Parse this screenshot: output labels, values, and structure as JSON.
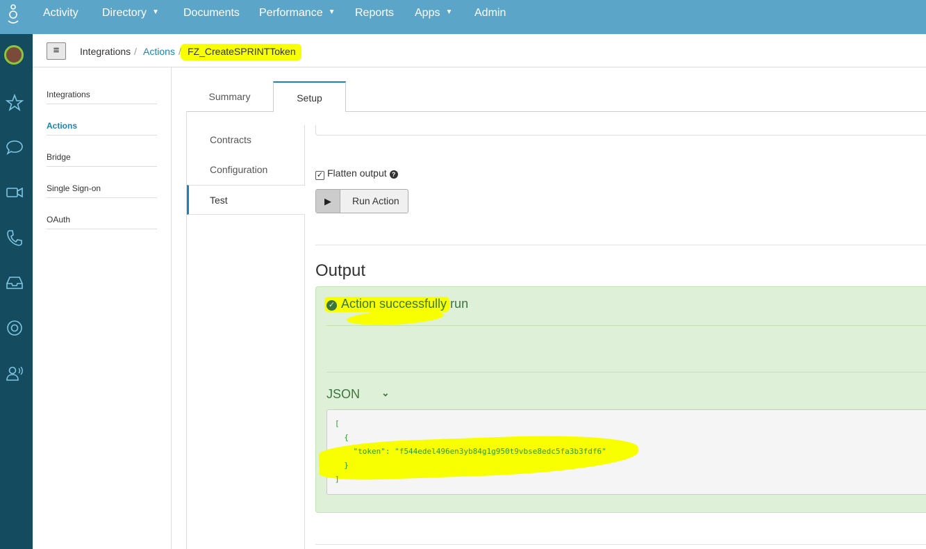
{
  "topnav": {
    "items": [
      {
        "label": "Activity",
        "has_caret": false
      },
      {
        "label": "Directory",
        "has_caret": true
      },
      {
        "label": "Documents",
        "has_caret": false
      },
      {
        "label": "Performance",
        "has_caret": true
      },
      {
        "label": "Reports",
        "has_caret": false
      },
      {
        "label": "Apps",
        "has_caret": true
      },
      {
        "label": "Admin",
        "has_caret": false
      }
    ],
    "caret_glyph": "▼"
  },
  "rail": {
    "icons": [
      "star-icon",
      "chat-icon",
      "video-icon",
      "phone-icon",
      "inbox-icon",
      "lifebuoy-icon",
      "voice-user-icon"
    ]
  },
  "breadcrumb": {
    "root": "Integrations",
    "parent": "Actions",
    "current": "FZ_CreateSPRINTToken",
    "separator": "/"
  },
  "sidebar": {
    "items": [
      {
        "label": "Integrations",
        "active": false
      },
      {
        "label": "Actions",
        "active": true
      },
      {
        "label": "Bridge",
        "active": false
      },
      {
        "label": "Single Sign-on",
        "active": false
      },
      {
        "label": "OAuth",
        "active": false
      }
    ]
  },
  "tabs": {
    "summary": "Summary",
    "setup": "Setup"
  },
  "subnav": {
    "contracts": "Contracts",
    "configuration": "Configuration",
    "test": "Test"
  },
  "test": {
    "flatten_label": "Flatten output",
    "flatten_checked": true,
    "run_label": "Run Action",
    "output_title": "Output",
    "success_message": "Action successfully run",
    "json_label": "JSON",
    "json_lines": [
      "[",
      "  {",
      "    \"token\": \"f544edel496en3yb84g1g950t9vbse8edc5fa3b3fdf6\"",
      "  }",
      "]"
    ]
  },
  "colors": {
    "topnav": "#5ba6c8",
    "rail": "#144b5e",
    "accent": "#1b83b5",
    "success_bg": "#dff0d8",
    "success_text": "#3c763d",
    "highlight": "#f7ff00"
  }
}
